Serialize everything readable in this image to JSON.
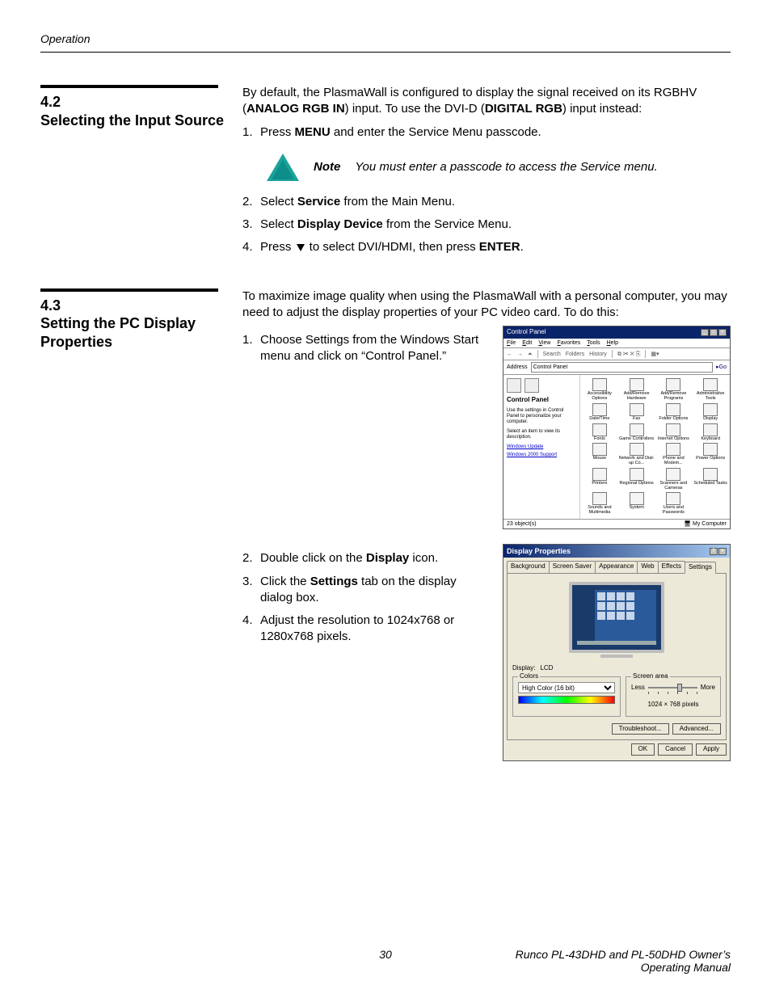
{
  "header": {
    "section_label": "Operation"
  },
  "section42": {
    "number": "4.2",
    "title": "Selecting the Input Source",
    "intro_pre": "By default, the PlasmaWall is configured to display the signal received on its RGBHV (",
    "intro_bold1": "ANALOG RGB IN",
    "intro_mid": ") input. To use the DVI-D (",
    "intro_bold2": "DIGITAL RGB",
    "intro_post": ") input instead:",
    "step1_num": "1.",
    "step1_pre": "Press ",
    "step1_bold": "MENU",
    "step1_post": " and enter the Service Menu passcode.",
    "note_label": "Note",
    "note_text": "You must enter a passcode to access the Service menu.",
    "step2_num": "2.",
    "step2_pre": "Select ",
    "step2_bold": "Service",
    "step2_post": " from the Main Menu.",
    "step3_num": "3.",
    "step3_pre": "Select ",
    "step3_bold": "Display Device",
    "step3_post": " from the Service Menu.",
    "step4_num": "4.",
    "step4_pre": "Press ",
    "step4_mid": " to select DVI/HDMI, then press ",
    "step4_bold": "ENTER",
    "step4_post": "."
  },
  "section43": {
    "number": "4.3",
    "title": "Setting the PC Display Properties",
    "intro": "To maximize image quality when using the PlasmaWall with a personal computer, you may need to adjust the display properties of your PC video card. To do this:",
    "step1_num": "1.",
    "step1_text": "Choose Settings from the Windows Start menu and click on “Control Panel.”",
    "step2_num": "2.",
    "step2_pre": "Double click on the ",
    "step2_bold": "Display",
    "step2_post": " icon.",
    "step3_num": "3.",
    "step3_pre": "Click the ",
    "step3_bold": "Settings",
    "step3_post": " tab on the display dialog box.",
    "step4_num": "4.",
    "step4_text": "Adjust the resolution to 1024x768 or 1280x768 pixels."
  },
  "control_panel": {
    "title": "Control Panel",
    "menu": [
      "File",
      "Edit",
      "View",
      "Favorites",
      "Tools",
      "Help"
    ],
    "toolbar": {
      "search": "Search",
      "folders": "Folders",
      "history": "History"
    },
    "address_label": "Address",
    "address_value": "Control Panel",
    "go": "Go",
    "side_title": "Control Panel",
    "side_text": "Use the settings in Control Panel to personalize your computer.",
    "side_hint": "Select an item to view its description.",
    "side_link1": "Windows Update",
    "side_link2": "Windows 2000 Support",
    "items": [
      "Accessibility Options",
      "Add/Remove Hardware",
      "Add/Remove Programs",
      "Administrative Tools",
      "Date/Time",
      "Fax",
      "Folder Options",
      "Display",
      "Fonts",
      "Game Controllers",
      "Internet Options",
      "Keyboard",
      "Mouse",
      "Network and Dial-up Co...",
      "Phone and Modem...",
      "Power Options",
      "Printers",
      "Regional Options",
      "Scanners and Cameras",
      "Scheduled Tasks",
      "Sounds and Multimedia",
      "System",
      "Users and Passwords"
    ],
    "status_left": "23 object(s)",
    "status_right": "My Computer"
  },
  "display_props": {
    "title": "Display Properties",
    "tabs": [
      "Background",
      "Screen Saver",
      "Appearance",
      "Web",
      "Effects",
      "Settings"
    ],
    "display_label": "Display:",
    "display_value": "LCD",
    "colors_legend": "Colors",
    "colors_value": "High Color (16 bit)",
    "screen_legend": "Screen area",
    "less": "Less",
    "more": "More",
    "resolution": "1024  ×  768 pixels",
    "troubleshoot": "Troubleshoot...",
    "advanced": "Advanced...",
    "ok": "OK",
    "cancel": "Cancel",
    "apply": "Apply"
  },
  "footer": {
    "page": "30",
    "text": "Runco PL-43DHD and PL-50DHD Owner’s Operating Manual"
  }
}
